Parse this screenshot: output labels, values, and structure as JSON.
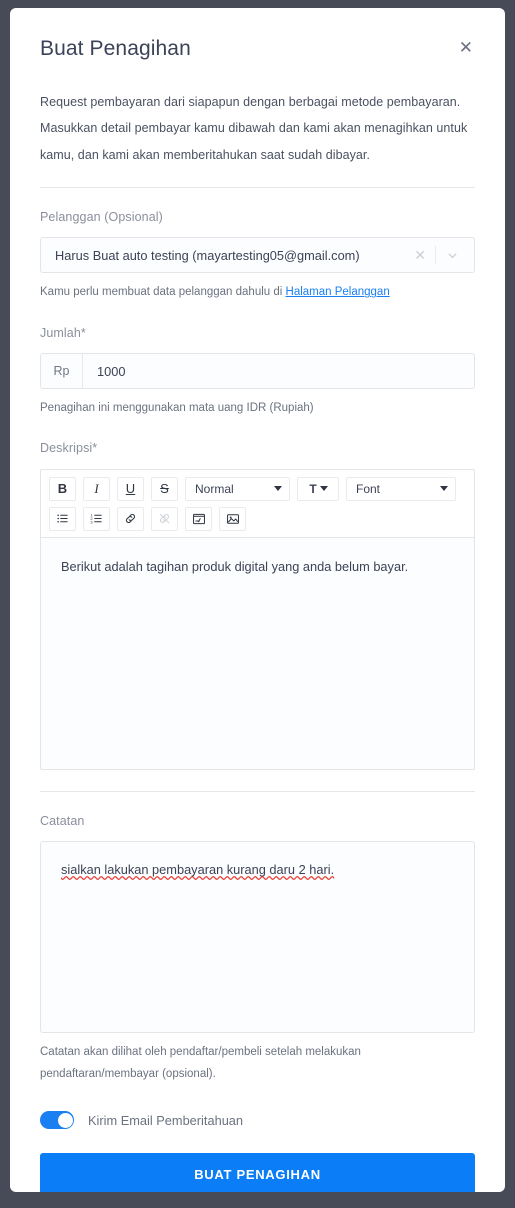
{
  "modal": {
    "title": "Buat Penagihan",
    "close_icon": "close-icon",
    "intro": "Request pembayaran dari siapapun dengan berbagai metode pembayaran. Masukkan detail pembayar kamu dibawah dan kami akan menagihkan untuk kamu, dan kami akan memberitahukan saat sudah dibayar."
  },
  "customer": {
    "label": "Pelanggan (Opsional)",
    "value": "Harus Buat auto testing (mayartesting05@gmail.com)",
    "clear_icon": "clear-icon",
    "dropdown_icon": "chevron-down-icon",
    "help_prefix": "Kamu perlu membuat data pelanggan dahulu di ",
    "help_link": "Halaman Pelanggan"
  },
  "amount": {
    "label": "Jumlah*",
    "currency_prefix": "Rp",
    "value": "1000",
    "placeholder": "0",
    "help": "Penagihan ini menggunakan mata uang IDR (Rupiah)"
  },
  "description": {
    "label": "Deskripsi*",
    "body_text": "Berikut adalah tagihan produk digital yang anda belum bayar.",
    "toolbar": {
      "row1": [
        {
          "name": "bold-button",
          "glyph": "B",
          "style": "b",
          "disabled": false
        },
        {
          "name": "italic-button",
          "glyph": "I",
          "style": "i",
          "disabled": false
        },
        {
          "name": "underline-button",
          "glyph": "U",
          "style": "u",
          "disabled": false
        },
        {
          "name": "strikethrough-button",
          "glyph": "S",
          "style": "s",
          "disabled": false
        }
      ],
      "heading_select": "Normal",
      "text_color_glyph": "T",
      "font_select": "Font",
      "row2": [
        {
          "name": "bullet-list-button",
          "glyph": "bullet-list-icon",
          "disabled": false
        },
        {
          "name": "numbered-list-button",
          "glyph": "numbered-list-icon",
          "disabled": false
        },
        {
          "name": "link-button",
          "glyph": "link-icon",
          "disabled": false
        },
        {
          "name": "unlink-button",
          "glyph": "unlink-icon",
          "disabled": true
        },
        {
          "name": "video-button",
          "glyph": "video-icon",
          "disabled": false
        },
        {
          "name": "image-button",
          "glyph": "image-icon",
          "disabled": false
        }
      ]
    }
  },
  "notes": {
    "label": "Catatan",
    "value": "sialkan lakukan pembayaran kurang daru 2 hari.",
    "placeholder": "",
    "help_line1": "Catatan akan dilihat oleh pendaftar/pembeli setelah melakukan",
    "help_line2": "pendaftaran/membayar (opsional)."
  },
  "notify": {
    "label": "Kirim Email Pemberitahuan",
    "enabled": true
  },
  "submit": {
    "label": "BUAT PENAGIHAN"
  },
  "colors": {
    "accent": "#0b7df7",
    "link": "#1a7ff0",
    "page_background": "#464b57",
    "card_background": "#ffffff",
    "border": "#e3e5e9",
    "label_text": "#8a8f9c",
    "body_text": "#3c4257"
  }
}
